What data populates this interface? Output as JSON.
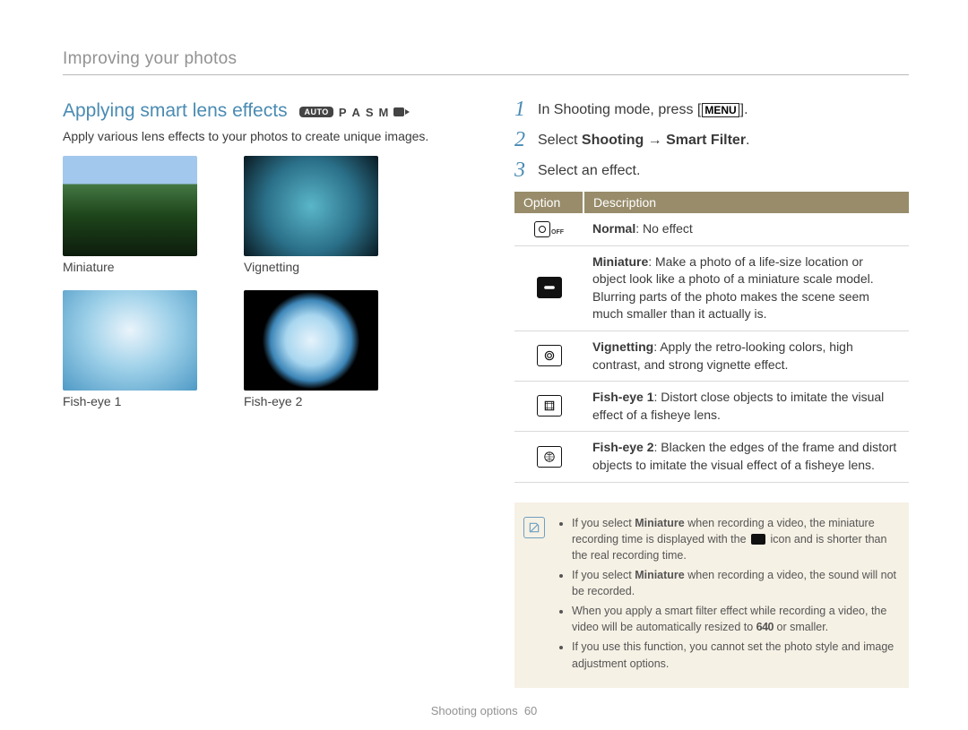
{
  "breadcrumb": "Improving your photos",
  "left": {
    "title": "Applying smart lens effects",
    "modes": {
      "auto": "AUTO",
      "p": "P",
      "a": "A",
      "s": "S",
      "m": "M"
    },
    "intro": "Apply various lens effects to your photos to create unique images.",
    "gallery": [
      {
        "label": "Miniature",
        "class": "miniature"
      },
      {
        "label": "Vignetting",
        "class": "vignetting"
      },
      {
        "label": "Fish-eye 1",
        "class": "fisheye1"
      },
      {
        "label": "Fish-eye 2",
        "class": "fisheye2"
      }
    ]
  },
  "steps": [
    {
      "n": "1",
      "pre": "In Shooting mode, press [",
      "chip": "MENU",
      "post": "]."
    },
    {
      "n": "2",
      "text_pre": "Select ",
      "strong": "Shooting → Smart Filter",
      "post": "."
    },
    {
      "n": "3",
      "text": "Select an effect."
    }
  ],
  "table": {
    "headers": {
      "opt": "Option",
      "desc": "Description"
    },
    "rows": [
      {
        "icon": "off",
        "name": "Normal",
        "desc": ": No effect"
      },
      {
        "icon": "miniature",
        "name": "Miniature",
        "desc": ": Make a photo of a life-size location or object look like a photo of a miniature scale model. Blurring parts of the photo makes the scene seem much smaller than it actually is."
      },
      {
        "icon": "vignetting",
        "name": "Vignetting",
        "desc": ": Apply the retro-looking colors, high contrast, and strong vignette effect."
      },
      {
        "icon": "fisheye1",
        "name": "Fish-eye 1",
        "desc": ": Distort close objects to imitate the visual effect of a fisheye lens."
      },
      {
        "icon": "fisheye2",
        "name": "Fish-eye 2",
        "desc": ": Blacken the edges of the frame and distort objects to imitate the visual effect of a fisheye lens."
      }
    ]
  },
  "notes": [
    {
      "pre": "If you select ",
      "b": "Miniature",
      "post_a": " when recording a video, the miniature recording time is displayed with the ",
      "post_b": " icon and is shorter than the real recording time.",
      "has_icon": true
    },
    {
      "pre": "If you select ",
      "b": "Miniature",
      "post_a": " when recording a video, the sound will not be recorded.",
      "post_b": "",
      "has_icon": false
    },
    {
      "plain_a": "When you apply a smart filter effect while recording a video, the video will be automatically resized to ",
      "res": "640",
      "plain_b": " or smaller."
    },
    {
      "plain_a": "If you use this function, you cannot set the photo style and image adjustment options.",
      "res": "",
      "plain_b": ""
    }
  ],
  "footer": {
    "section": "Shooting options",
    "page": "60"
  }
}
